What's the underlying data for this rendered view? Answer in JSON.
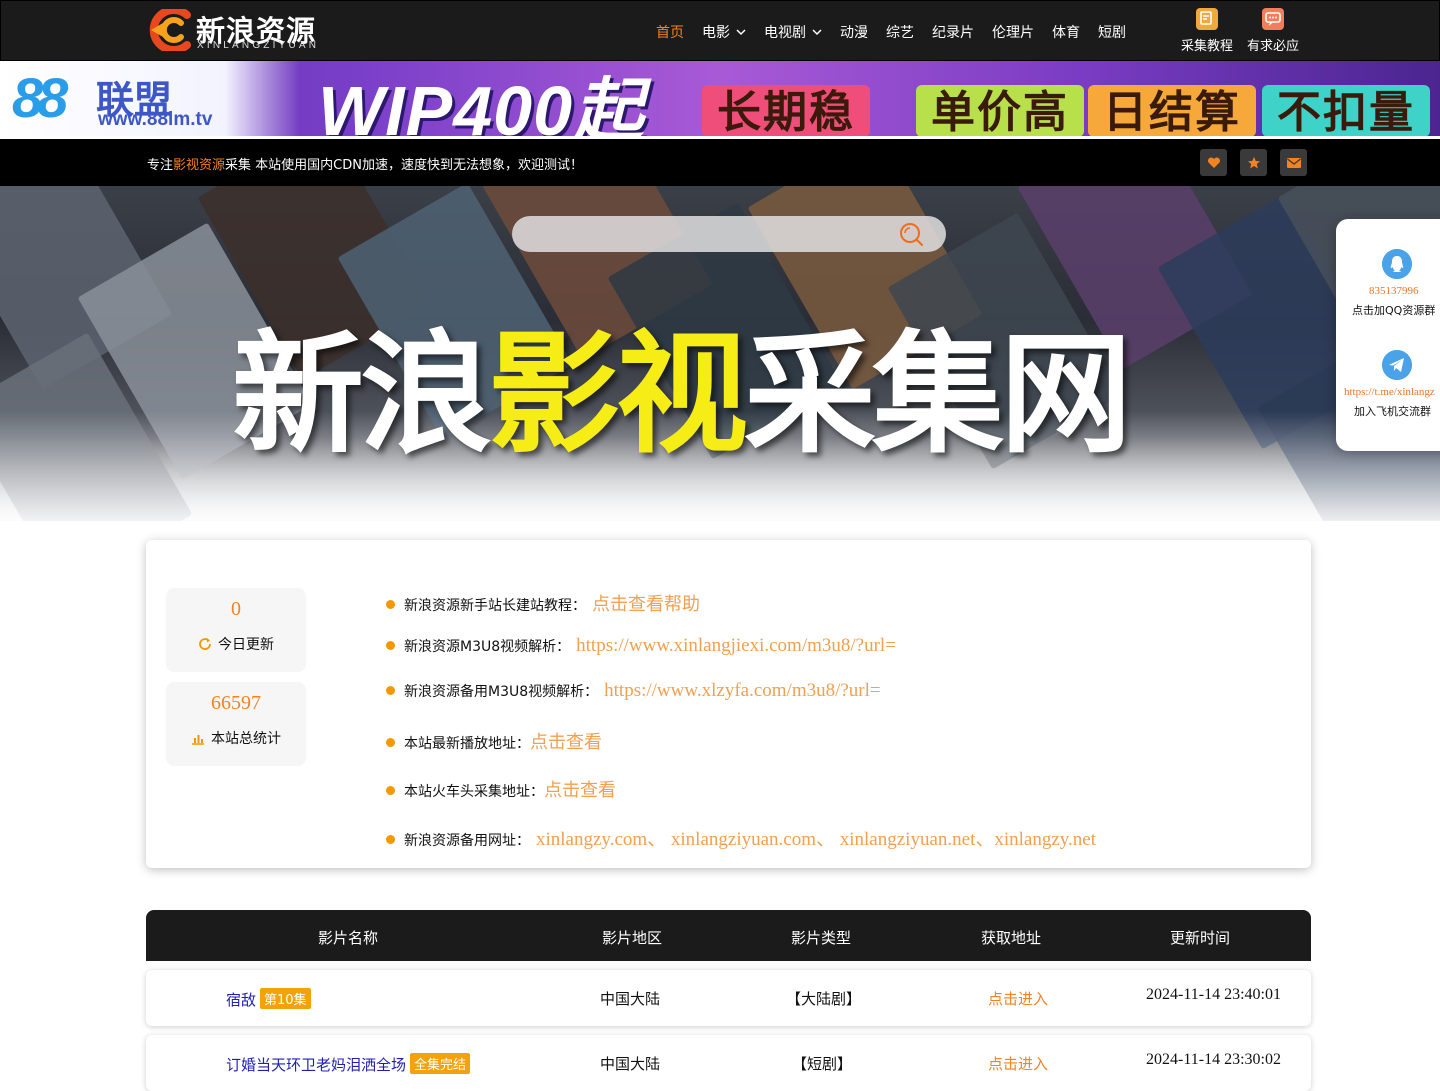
{
  "header": {
    "logo_text": "新浪资源",
    "logo_sub": "XINLANGZIYUAN",
    "nav": [
      {
        "label": "首页",
        "active": true,
        "dropdown": false
      },
      {
        "label": "电影",
        "active": false,
        "dropdown": true
      },
      {
        "label": "电视剧",
        "active": false,
        "dropdown": true
      },
      {
        "label": "动漫",
        "active": false,
        "dropdown": false
      },
      {
        "label": "综艺",
        "active": false,
        "dropdown": false
      },
      {
        "label": "纪录片",
        "active": false,
        "dropdown": false
      },
      {
        "label": "伦理片",
        "active": false,
        "dropdown": false
      },
      {
        "label": "体育",
        "active": false,
        "dropdown": false
      },
      {
        "label": "短剧",
        "active": false,
        "dropdown": false
      }
    ],
    "tools": [
      {
        "label": "采集教程",
        "icon": "tutorial-icon",
        "color": "#f2a93b"
      },
      {
        "label": "有求必应",
        "icon": "chat-icon",
        "color": "#f07f5a"
      }
    ],
    "accent": "#f58220"
  },
  "ad": {
    "brand_num": "88",
    "brand_name": "联盟",
    "brand_url": "www.88lm.tv",
    "headline": "WIP400起",
    "tags": [
      {
        "text": "长期稳定",
        "color": "#f04e7a"
      },
      {
        "text": "单价高",
        "color": "#b8e04a"
      },
      {
        "text": "日结算",
        "color": "#f6a93a"
      },
      {
        "text": "不扣量",
        "color": "#3ed2c8"
      }
    ]
  },
  "notice": {
    "prefix": "专注",
    "highlight": "影视资源",
    "suffix": "采集 本站使用国内CDN加速，速度快到无法想象，欢迎测试！",
    "icons": [
      "heart-icon",
      "star-icon",
      "mail-icon"
    ]
  },
  "hero": {
    "search_placeholder": "",
    "title_part1": "新浪",
    "title_part2": "影视",
    "title_part3": "采集网"
  },
  "side_panel": [
    {
      "value": "835137996",
      "label": "点击加QQ资源群",
      "icon": "qq-icon"
    },
    {
      "value": "https://t.me/xinlangz",
      "label": "加入飞机交流群",
      "icon": "telegram-icon"
    }
  ],
  "stats": [
    {
      "value": "0",
      "label": "今日更新",
      "icon": "refresh-icon"
    },
    {
      "value": "66597",
      "label": "本站总统计",
      "icon": "bar-chart-icon"
    }
  ],
  "info": [
    {
      "label": "新浪资源新手站长建站教程：",
      "link": "点击查看帮助",
      "cjk": true
    },
    {
      "label": "新浪资源M3U8视频解析：",
      "link": "https://www.xinlangjiexi.com/m3u8/?url=",
      "cjk": false
    },
    {
      "label": "新浪资源备用M3U8视频解析：",
      "link": "https://www.xlzyfa.com/m3u8/?url=",
      "cjk": false
    },
    {
      "label": "本站最新播放地址：",
      "link": "点击查看",
      "cjk": true
    },
    {
      "label": "本站火车头采集地址：",
      "link": "点击查看",
      "cjk": true
    },
    {
      "label": "新浪资源备用网址：",
      "link": "xinlangzy.com、 xinlangziyuan.com、 xinlangziyuan.net、xinlangzy.net",
      "cjk": false
    }
  ],
  "table": {
    "headers": [
      "影片名称",
      "影片地区",
      "影片类型",
      "获取地址",
      "更新时间"
    ],
    "rows": [
      {
        "name": "宿敌",
        "badge": "第10集",
        "region": "中国大陆",
        "type": "【大陆剧】",
        "link": "点击进入",
        "time": "2024-11-14 23:40:01"
      },
      {
        "name": "订婚当天环卫老妈泪洒全场",
        "badge": "全集完结",
        "region": "中国大陆",
        "type": "【短剧】",
        "link": "点击进入",
        "time": "2024-11-14 23:30:02"
      }
    ]
  }
}
